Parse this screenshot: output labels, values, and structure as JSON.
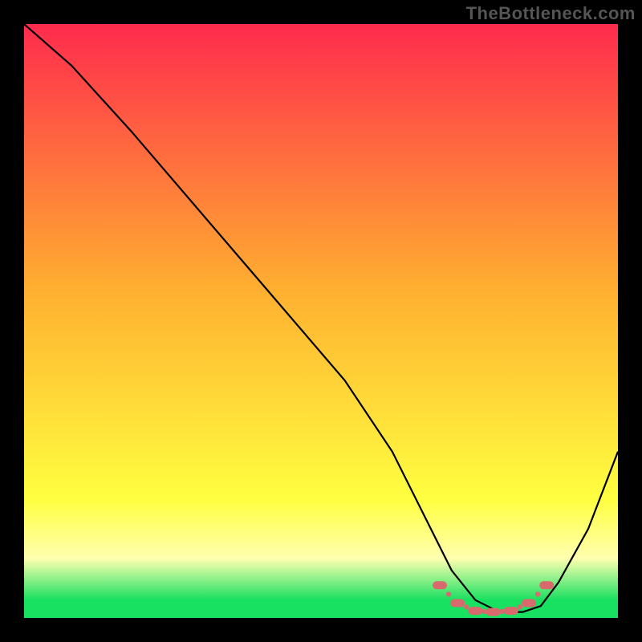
{
  "watermark": "TheBottleneck.com",
  "colors": {
    "frame": "#000000",
    "grad_top": "#ff2b4d",
    "grad_mid": "#ffb030",
    "grad_yellow": "#ffff40",
    "grad_band": "#ffffb0",
    "grad_green": "#18e060",
    "curve": "#000000",
    "marker": "#d86a6e"
  },
  "chart_data": {
    "type": "line",
    "title": "",
    "xlabel": "",
    "ylabel": "",
    "ylim": [
      0,
      100
    ],
    "xlim": [
      0,
      100
    ],
    "series": [
      {
        "name": "bottleneck-curve",
        "x": [
          0,
          8,
          18,
          30,
          42,
          54,
          62,
          68,
          72,
          76,
          80,
          84,
          87,
          90,
          95,
          100
        ],
        "values": [
          100,
          93,
          82,
          68,
          54,
          40,
          28,
          16,
          8,
          3,
          1,
          1,
          2,
          6,
          15,
          28
        ]
      }
    ],
    "markers": {
      "name": "optimal-range",
      "x": [
        70,
        73,
        76,
        79,
        82,
        85,
        88
      ],
      "values": [
        5.5,
        2.5,
        1.2,
        1.0,
        1.2,
        2.5,
        5.5
      ]
    },
    "gradient_stops": [
      {
        "offset": 0.0,
        "color_key": "grad_top"
      },
      {
        "offset": 0.45,
        "color_key": "grad_mid"
      },
      {
        "offset": 0.8,
        "color_key": "grad_yellow"
      },
      {
        "offset": 0.9,
        "color_key": "grad_band"
      },
      {
        "offset": 0.97,
        "color_key": "grad_green"
      },
      {
        "offset": 1.0,
        "color_key": "grad_green"
      }
    ]
  }
}
